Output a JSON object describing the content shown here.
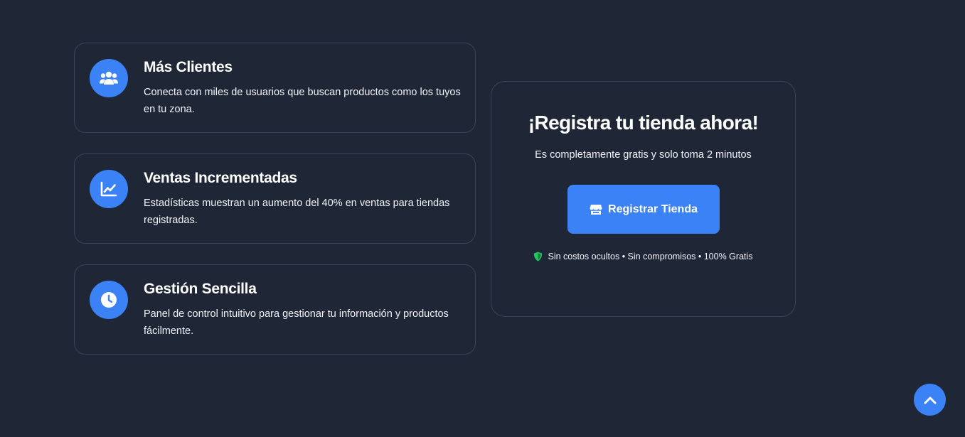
{
  "features": [
    {
      "icon": "users-icon",
      "title": "Más Clientes",
      "description": "Conecta con miles de usuarios que buscan productos como los tuyos en tu zona."
    },
    {
      "icon": "chart-line-icon",
      "title": "Ventas Incrementadas",
      "description": "Estadísticas muestran un aumento del 40% en ventas para tiendas registradas."
    },
    {
      "icon": "clock-icon",
      "title": "Gestión Sencilla",
      "description": "Panel de control intuitivo para gestionar tu información y productos fácilmente."
    }
  ],
  "register": {
    "title": "¡Registra tu tienda ahora!",
    "subtitle": "Es completamente gratis y solo toma 2 minutos",
    "button_icon": "store-icon",
    "button_label": "Registrar Tienda",
    "note_icon": "shield-check-icon",
    "note": "Sin costos ocultos • Sin compromisos • 100% Gratis"
  },
  "back_to_top": {
    "icon": "chevron-up-icon"
  },
  "colors": {
    "background": "#1f2737",
    "card_border": "#3a4456",
    "accent": "#3b82f6",
    "shield": "#22c55e",
    "text": "#ffffff"
  }
}
